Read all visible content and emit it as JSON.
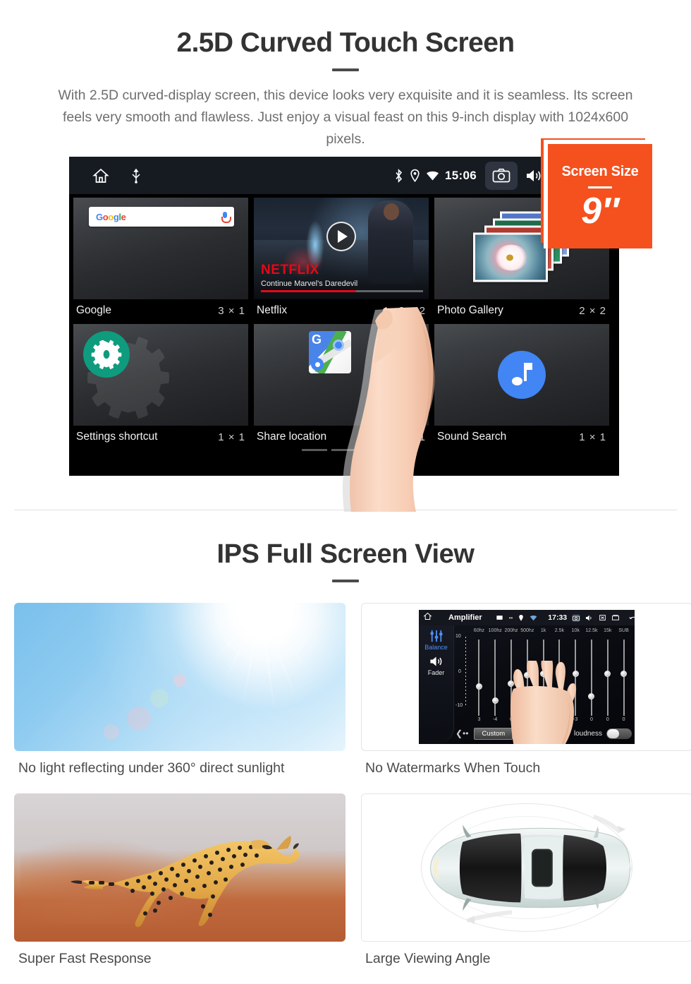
{
  "section1": {
    "title": "2.5D Curved Touch Screen",
    "description": "With 2.5D curved-display screen, this device looks very exquisite and it is seamless. Its screen feels very smooth and flawless. Just enjoy a visual feast on this 9-inch display with 1024x600 pixels.",
    "badge": {
      "label": "Screen Size",
      "value": "9″",
      "color": "#f4511e"
    },
    "device": {
      "statusbar": {
        "time": "15:06",
        "left_icons": [
          "home-icon",
          "usb-icon"
        ],
        "right_icons": [
          "bluetooth-icon",
          "location-icon",
          "wifi-icon",
          "camera-icon",
          "volume-icon",
          "close-icon",
          "recents-icon"
        ]
      },
      "widgets": [
        {
          "name": "Google",
          "size": "3 × 1",
          "search_placeholder": "Google"
        },
        {
          "name": "Netflix",
          "size": "3 × 2",
          "tile_logo": "NETFLIX",
          "tile_caption": "Continue Marvel's Daredevil"
        },
        {
          "name": "Photo Gallery",
          "size": "2 × 2"
        },
        {
          "name": "Settings shortcut",
          "size": "1 × 1"
        },
        {
          "name": "Share location",
          "size": "1 × 1"
        },
        {
          "name": "Sound Search",
          "size": "1 × 1"
        }
      ],
      "page_indicator": {
        "count": 3,
        "active": 3
      }
    }
  },
  "section2": {
    "title": "IPS Full Screen View",
    "cards": [
      {
        "caption": "No light reflecting under 360° direct sunlight",
        "image": "blue-sky-sunlight"
      },
      {
        "caption": "No Watermarks When Touch",
        "image": "amplifier-equalizer-screenshot"
      },
      {
        "caption": "Super Fast Response",
        "image": "running-cheetah"
      },
      {
        "caption": "Large Viewing Angle",
        "image": "car-top-view"
      }
    ],
    "amplifier": {
      "title": "Amplifier",
      "time": "17:33",
      "side_labels": [
        "Balance",
        "Fader"
      ],
      "scale_top": "10",
      "scale_mid": "0",
      "scale_bottom": "-10",
      "bands": [
        "60hz",
        "100hz",
        "200hz",
        "500hz",
        "1k",
        "2.5k",
        "10k",
        "12.5k",
        "15k",
        "SUB"
      ],
      "values": [
        "3",
        "-4",
        "0",
        "0",
        "-3",
        "0",
        "-3",
        "0",
        "0",
        "0"
      ],
      "preset": "Custom",
      "loudness_label": "loudness",
      "loudness_on": false
    }
  }
}
